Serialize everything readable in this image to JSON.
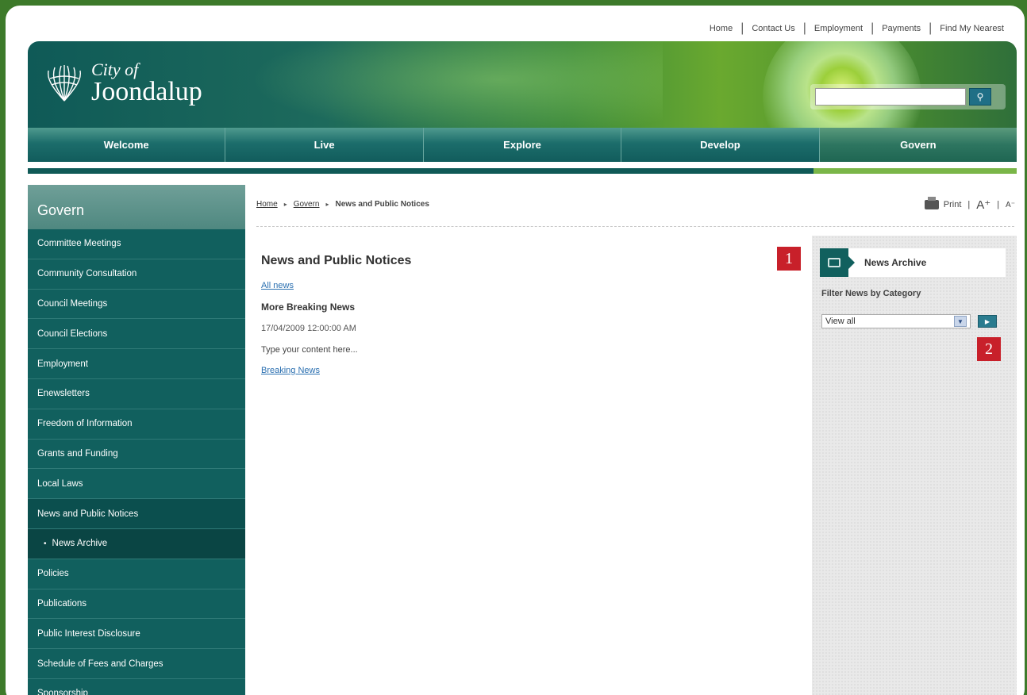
{
  "toplinks": [
    "Home",
    "Contact Us",
    "Employment",
    "Payments",
    "Find My Nearest"
  ],
  "logo": {
    "line1": "City of",
    "line2": "Joondalup"
  },
  "search": {
    "placeholder": ""
  },
  "mainnav": [
    "Welcome",
    "Live",
    "Explore",
    "Develop",
    "Govern"
  ],
  "sidebar": {
    "heading": "Govern",
    "items": [
      "Committee Meetings",
      "Community Consultation",
      "Council Meetings",
      "Council Elections",
      "Employment",
      "Enewsletters",
      "Freedom of Information",
      "Grants and Funding",
      "Local Laws",
      "News and Public Notices",
      "News Archive",
      "Policies",
      "Publications",
      "Public Interest Disclosure",
      "Schedule of Fees and Charges",
      "Sponsorship"
    ]
  },
  "breadcrumb": {
    "home": "Home",
    "govern": "Govern",
    "current": "News and Public Notices"
  },
  "tools": {
    "print": "Print",
    "increase": "A⁺",
    "decrease": "A⁻"
  },
  "content": {
    "heading": "News and Public Notices",
    "all_news": "All news",
    "item_title": "More Breaking News",
    "item_date": "17/04/2009 12:00:00 AM",
    "item_body": "Type your content here...",
    "category_link": "Breaking News"
  },
  "panel": {
    "title": "News Archive",
    "filter_label": "Filter News by Category",
    "select_value": "View all"
  },
  "markers": [
    "1",
    "2"
  ],
  "colors": {
    "teal": "#11605e",
    "green_frame": "#3d7a2a",
    "marker_red": "#c8202a"
  }
}
